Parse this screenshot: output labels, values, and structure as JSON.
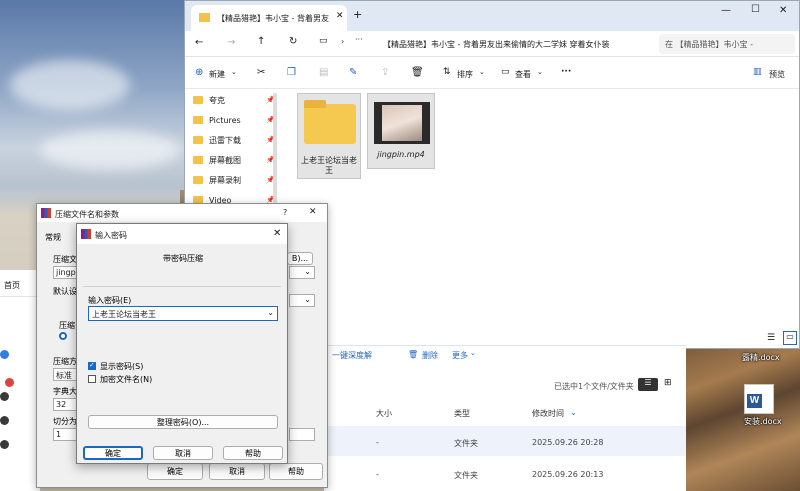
{
  "explorer": {
    "tab_title": "【精品猎艳】韦小宝 - 背着男友",
    "address_text": "【精品猎艳】韦小宝 - 背着男友出来偷情的大二学妹 穿着女仆装",
    "search_placeholder": "在 【精品猎艳】韦小宝 -",
    "toolbar": {
      "new": "新建",
      "sort": "排序",
      "view": "查看",
      "more": "···",
      "preview": "预览"
    },
    "nav_items": [
      {
        "label": "夸克"
      },
      {
        "label": "Pictures"
      },
      {
        "label": "迅雷下载"
      },
      {
        "label": "屏幕截图"
      },
      {
        "label": "屏幕录制"
      },
      {
        "label": "Video"
      }
    ],
    "files": [
      {
        "name": "上老王论坛当老王"
      },
      {
        "name": "jingpin.mp4"
      }
    ]
  },
  "lower_explorer": {
    "toolbar": {
      "unzip": "一键深度解",
      "delete": "删除",
      "more": "更多"
    },
    "status": "已选中1个文件/文件夹",
    "columns": {
      "size": "大小",
      "type": "类型",
      "modified": "修改时间"
    },
    "rows": [
      {
        "size": "-",
        "type": "文件夹",
        "modified": "2025.09.26 20:28"
      },
      {
        "size": "-",
        "type": "文件夹",
        "modified": "2025.09.26 20:13"
      }
    ]
  },
  "left_strip": {
    "home": "首页"
  },
  "desktop": {
    "top_label": "露精.docx",
    "word_label": "安装.docx"
  },
  "compress_dialog": {
    "title": "压缩文件名和参数",
    "help_glyph": "?",
    "tab_general": "常规",
    "label_filename_partial": "压缩文",
    "filename_partial": "jingpin",
    "browse_partial": "B)...",
    "label_default_partial": "默认设",
    "label_format_partial": "压缩",
    "label_method_partial": "压缩方",
    "method_partial": "标准",
    "label_dict_partial": "字典大",
    "dict_partial": "32",
    "label_split_partial": "切分为",
    "split_partial": "1",
    "ok": "确定",
    "cancel": "取消",
    "help": "帮助"
  },
  "password_dialog": {
    "title": "输入密码",
    "heading": "带密码压缩",
    "password_label": "输入密码(E)",
    "password_value": "上老王论坛当老王",
    "show_password": "显示密码(S)",
    "show_password_checked": true,
    "encrypt_names": "加密文件名(N)",
    "encrypt_names_checked": false,
    "organize": "整理密码(O)...",
    "ok": "确定",
    "cancel": "取消",
    "help": "帮助"
  }
}
